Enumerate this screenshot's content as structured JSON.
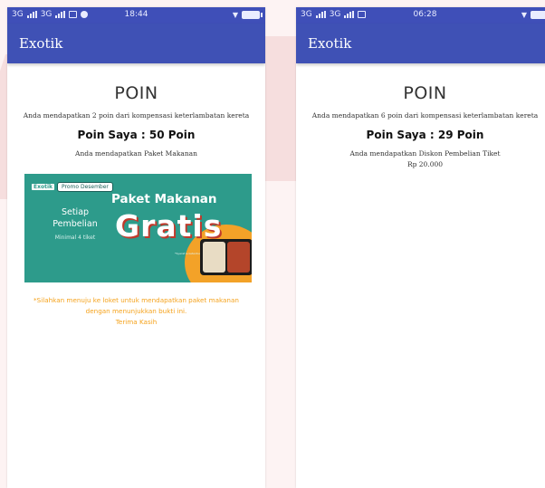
{
  "left": {
    "status": {
      "time": "18:44",
      "network_1": "3G",
      "network_2": "3G"
    },
    "app_title": "Exotik",
    "heading": "POIN",
    "compensation_text": "Anda mendapatkan 2 poin dari kompensasi keterlambatan kereta",
    "points_text": "Poin Saya : 50 Poin",
    "reward_text": "Anda mendapatkan Paket Makanan",
    "promo": {
      "brand": "Exotik",
      "tag": "Promo Desember",
      "setiap": "Setiap",
      "pembelian": "Pembelian",
      "minimal": "Minimal 4 tiket",
      "paket": "Paket Makanan",
      "gratis": "Gratis",
      "fine_print": "*Syarat & ketentuan berlaku"
    },
    "notice_line1": "*Silahkan menuju ke loket untuk mendapatkan paket makanan",
    "notice_line2": "dengan menunjukkan bukti ini.",
    "notice_line3": "Terima Kasih"
  },
  "right": {
    "status": {
      "time": "06:28",
      "network_1": "3G",
      "network_2": "3G"
    },
    "app_title": "Exotik",
    "heading": "POIN",
    "compensation_text": "Anda mendapatkan 6 poin dari kompensasi keterlambatan kereta",
    "points_text": "Poin Saya : 29 Poin",
    "reward_text": "Anda mendapatkan Diskon Pembelian Tiket",
    "amount_text": "Rp 20.000"
  },
  "colors": {
    "app_bar": "#3f51b5",
    "promo_green": "#2d9b8b",
    "promo_orange": "#f3a228",
    "notice_orange": "#f5a21b"
  }
}
